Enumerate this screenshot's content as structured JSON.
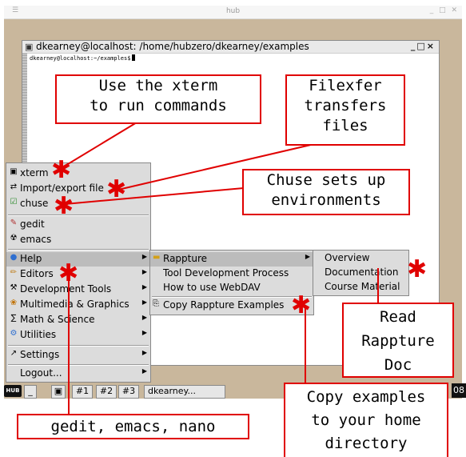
{
  "window": {
    "title": "hub"
  },
  "xterm": {
    "title": "dkearney@localhost: /home/hubzero/dkearney/examples",
    "prompt": "dkearney@localhost:~/examples$",
    "controls": "_□×"
  },
  "start_menu": {
    "items": [
      {
        "label": "xterm",
        "icon": "terminal-icon",
        "glyph": "🖥"
      },
      {
        "label": "Import/export file",
        "icon": "filexfer-icon",
        "glyph": "⇄"
      },
      {
        "label": "chuse",
        "icon": "checkbox-icon",
        "glyph": "☑"
      },
      {
        "label": "gedit",
        "icon": "gedit-icon",
        "glyph": "✎"
      },
      {
        "label": "emacs",
        "icon": "emacs-icon",
        "glyph": "☢"
      },
      {
        "label": "Help",
        "icon": "help-icon",
        "glyph": "●"
      },
      {
        "label": "Editors",
        "icon": "editor-icon",
        "glyph": "✏"
      },
      {
        "label": "Development Tools",
        "icon": "tools-icon",
        "glyph": "⚒"
      },
      {
        "label": "Multimedia & Graphics",
        "icon": "multimedia-icon",
        "glyph": "❀"
      },
      {
        "label": "Math & Science",
        "icon": "math-icon",
        "glyph": "∑"
      },
      {
        "label": "Utilities",
        "icon": "utilities-icon",
        "glyph": "⚙"
      },
      {
        "label": "Settings",
        "icon": "settings-icon",
        "glyph": "↗"
      },
      {
        "label": "Logout...",
        "icon": "",
        "glyph": ""
      }
    ]
  },
  "help_submenu": {
    "items": [
      {
        "label": "Rappture"
      },
      {
        "label": "Tool Development Process"
      },
      {
        "label": "How to use WebDAV"
      },
      {
        "label": "Copy Rappture Examples"
      }
    ]
  },
  "rappture_submenu": {
    "items": [
      {
        "label": "Overview"
      },
      {
        "label": "Documentation"
      },
      {
        "label": "Course Material"
      }
    ]
  },
  "taskbar": {
    "hub_label": "HUB",
    "workspaces": [
      "#1",
      "#2",
      "#3"
    ],
    "task_label": "dkearney...",
    "clock": "08"
  },
  "annotations": {
    "xterm_note": [
      "Use the xterm",
      "to run commands"
    ],
    "filexfer_note": [
      "Filexfer",
      "transfers",
      "files"
    ],
    "chuse_note": [
      "Chuse sets up",
      "environments"
    ],
    "read_doc_note": [
      "Read",
      "Rappture",
      "Doc"
    ],
    "copy_examples_note": [
      "Copy examples",
      "to your home",
      "directory"
    ],
    "editors_note": [
      "gedit, emacs, nano"
    ]
  },
  "colors": {
    "annotation": "#e00000",
    "desktop": "#c9b79c",
    "menu": "#dcdcdc"
  }
}
